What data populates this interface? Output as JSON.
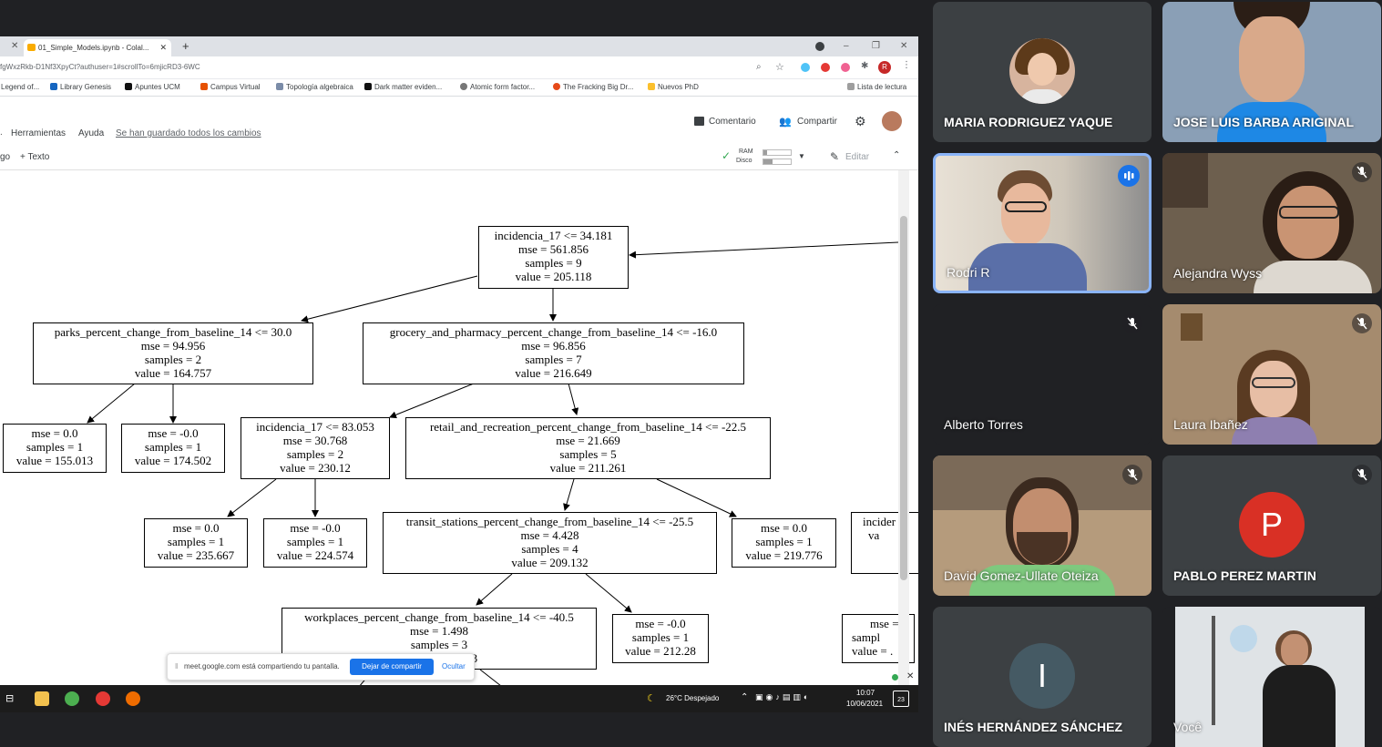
{
  "browser": {
    "tab_title": "01_Simple_Models.ipynb - Colal...",
    "url": "fgWxzRkb-D1Nf3XpyCt?authuser=1#scrollTo=6mjicRD3-6WC",
    "bookmarks": [
      "Legend of...",
      "Library Genesis",
      "Apuntes UCM",
      "Campus Virtual",
      "Topología algebraica",
      "Dark matter eviden...",
      "Atomic form factor...",
      "The Fracking Big Dr...",
      "Nuevos PhD"
    ],
    "reading_list": "Lista de lectura",
    "profile_initial": "R"
  },
  "colab": {
    "menu_tools": "Herramientas",
    "menu_help": "Ayuda",
    "saved_status": "Se han guardado todos los cambios",
    "comment_label": "Comentario",
    "share_label": "Compartir",
    "add_code": "go",
    "add_text": "+ Texto",
    "ram_label": "RAM",
    "disk_label": "Disco",
    "edit_label": "Editar"
  },
  "tree": {
    "root": [
      "incidencia_17 <= 34.181",
      "mse = 561.856",
      "samples = 9",
      "value = 205.118"
    ],
    "parks": [
      "parks_percent_change_from_baseline_14 <= 30.0",
      "mse = 94.956",
      "samples = 2",
      "value = 164.757"
    ],
    "grocery": [
      "grocery_and_pharmacy_percent_change_from_baseline_14 <= -16.0",
      "mse = 96.856",
      "samples = 7",
      "value = 216.649"
    ],
    "leaf1": [
      "mse = 0.0",
      "samples = 1",
      "value = 155.013"
    ],
    "leaf2": [
      "mse = -0.0",
      "samples = 1",
      "value = 174.502"
    ],
    "incid83": [
      "incidencia_17 <= 83.053",
      "mse = 30.768",
      "samples = 2",
      "value = 230.12"
    ],
    "retail": [
      "retail_and_recreation_percent_change_from_baseline_14 <= -22.5",
      "mse = 21.669",
      "samples = 5",
      "value = 211.261"
    ],
    "leaf3": [
      "mse = 0.0",
      "samples = 1",
      "value = 235.667"
    ],
    "leaf4": [
      "mse = -0.0",
      "samples = 1",
      "value = 224.574"
    ],
    "transit": [
      "transit_stations_percent_change_from_baseline_14 <= -25.5",
      "mse = 4.428",
      "samples = 4",
      "value = 209.132"
    ],
    "leaf5": [
      "mse = 0.0",
      "samples = 1",
      "value = 219.776"
    ],
    "right_cut": [
      "incider",
      "",
      "",
      "va"
    ],
    "workplaces": [
      "workplaces_percent_change_from_baseline_14 <= -40.5",
      "mse = 1.498",
      "samples = 3",
      "value = 208.083"
    ],
    "leaf6": [
      "mse = -0.0",
      "samples = 1",
      "value = 212.28"
    ],
    "right_cut2": [
      "mse =",
      "sampl",
      "value = ."
    ]
  },
  "share_banner": {
    "message": "meet.google.com está compartiendo tu pantalla.",
    "stop_button": "Dejar de compartir",
    "hide_link": "Ocultar"
  },
  "taskbar": {
    "weather": "26°C  Despejado",
    "time": "10:07",
    "date": "10/06/2021",
    "notif_count": "23"
  },
  "participants": [
    {
      "name": "MARIA RODRIGUEZ YAQUE",
      "muted": false
    },
    {
      "name": "JOSE LUIS BARBA ARIGINAL",
      "muted": false
    },
    {
      "name": "Rodri R",
      "muted": false,
      "speaking": true
    },
    {
      "name": "Alejandra Wyss",
      "muted": true
    },
    {
      "name": "Alberto Torres",
      "muted": true
    },
    {
      "name": "Laura Ibañez",
      "muted": true
    },
    {
      "name": "David Gomez-Ullate Oteiza",
      "muted": true
    },
    {
      "name": "PABLO PEREZ MARTIN",
      "muted": true,
      "initial": "P",
      "avatar_color": "#d93025"
    },
    {
      "name": "INÉS HERNÁNDEZ SÁNCHEZ",
      "muted": false,
      "initial": "I",
      "avatar_color": "#455a64"
    },
    {
      "name": "Você",
      "muted": false
    }
  ]
}
